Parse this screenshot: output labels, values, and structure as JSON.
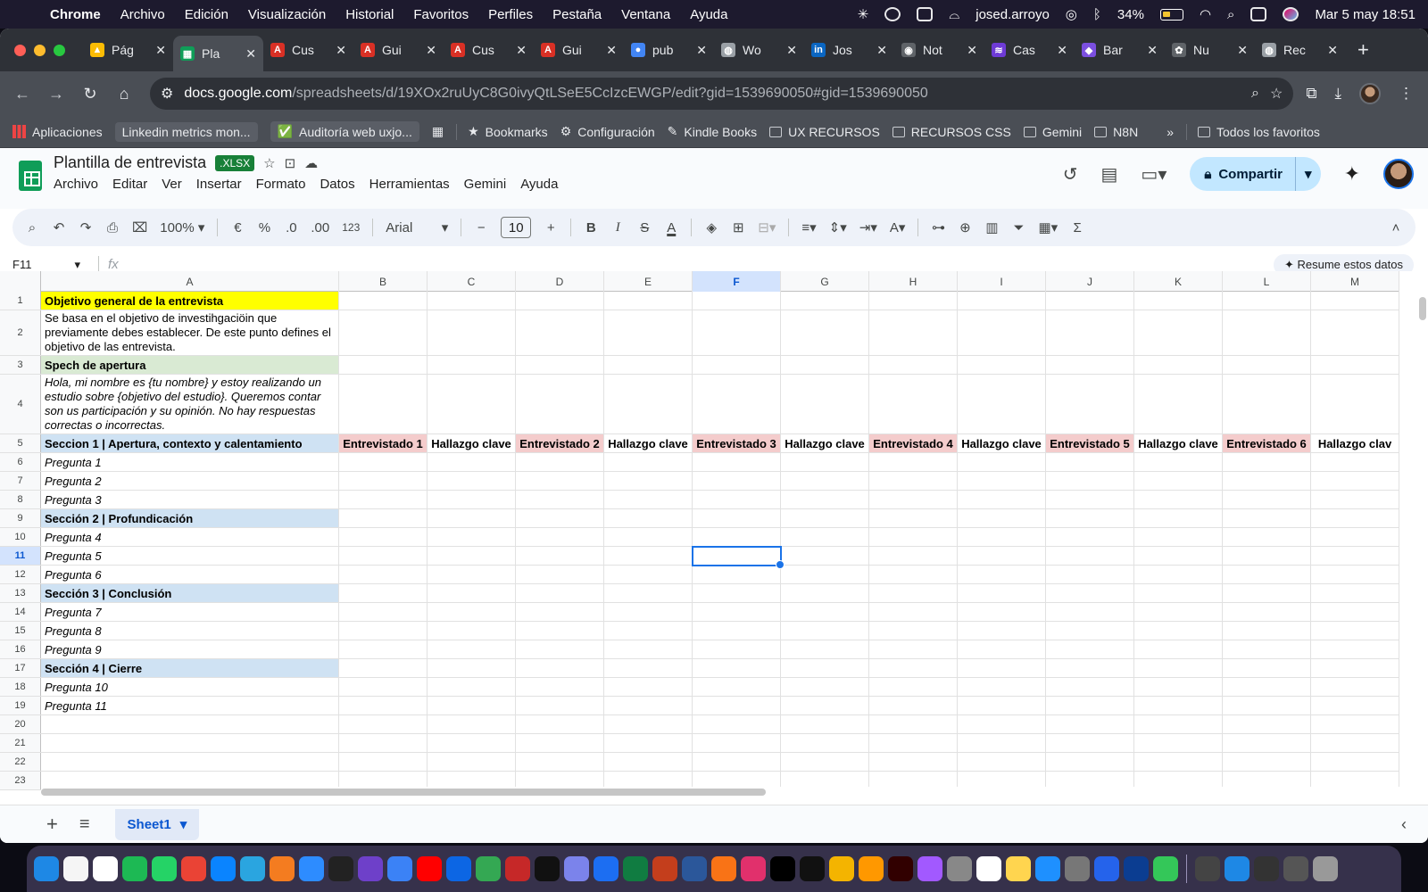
{
  "menubar": {
    "app": "Chrome",
    "items": [
      "Archivo",
      "Edición",
      "Visualización",
      "Historial",
      "Favoritos",
      "Perfiles",
      "Pestaña",
      "Ventana",
      "Ayuda"
    ],
    "user": "josed.arroyo",
    "battery": "34%",
    "datetime": "Mar 5 may  18:51"
  },
  "tabs": [
    {
      "label": "Pág",
      "color": "#fbbc04",
      "glyph": "▲"
    },
    {
      "label": "Pla",
      "color": "#0f9d58",
      "glyph": "▦",
      "active": true
    },
    {
      "label": "Cus",
      "color": "#d93025",
      "glyph": "A"
    },
    {
      "label": "Gui",
      "color": "#d93025",
      "glyph": "A"
    },
    {
      "label": "Cus",
      "color": "#d93025",
      "glyph": "A"
    },
    {
      "label": "Gui",
      "color": "#d93025",
      "glyph": "A"
    },
    {
      "label": "pub",
      "color": "#4285f4",
      "glyph": "●"
    },
    {
      "label": "Wo",
      "color": "#9aa0a6",
      "glyph": "◍"
    },
    {
      "label": "Jos",
      "color": "#0a66c2",
      "glyph": "in"
    },
    {
      "label": "Not",
      "color": "#5f6368",
      "glyph": "◉"
    },
    {
      "label": "Cas",
      "color": "#6e3bd6",
      "glyph": "≋"
    },
    {
      "label": "Bar",
      "color": "#7b4fe0",
      "glyph": "◆"
    },
    {
      "label": "Nu",
      "color": "#5f6368",
      "glyph": "✿"
    },
    {
      "label": "Rec",
      "color": "#9aa0a6",
      "glyph": "◍"
    }
  ],
  "toolbar": {
    "url_host": "docs.google.com",
    "url_path": "/spreadsheets/d/19XOx2ruUyC8G0ivyQtLSeE5CcIzcEWGP/edit?gid=1539690050#gid=1539690050"
  },
  "bookmarks": {
    "apps": "Aplicaciones",
    "items": [
      "Linkedin metrics mon...",
      "Auditoría web uxjo...",
      "Bookmarks",
      "Configuración",
      "Kindle Books",
      "UX RECURSOS",
      "RECURSOS CSS",
      "Gemini",
      "N8N"
    ],
    "more": "»",
    "all": "Todos los favoritos"
  },
  "doc": {
    "title": "Plantilla de entrevista",
    "badge": ".XLSX",
    "menus": [
      "Archivo",
      "Editar",
      "Ver",
      "Insertar",
      "Formato",
      "Datos",
      "Herramientas",
      "Gemini",
      "Ayuda"
    ],
    "share": "Compartir"
  },
  "format": {
    "zoom": "100%",
    "currency": "€",
    "percent": "%",
    "dec_less": ".0",
    "dec_more": ".00",
    "numfmt": "123",
    "font": "Arial",
    "size": "10"
  },
  "formula": {
    "namebox": "F11",
    "fx": "fx",
    "summary": "Resume estos datos"
  },
  "columns": [
    "A",
    "B",
    "C",
    "D",
    "E",
    "F",
    "G",
    "H",
    "I",
    "J",
    "K",
    "L",
    "M"
  ],
  "selected": {
    "col": "F",
    "row": "11"
  },
  "rows": [
    {
      "n": "1",
      "cells": [
        {
          "t": "Objetivo general de la entrevista",
          "s": "b yl"
        }
      ]
    },
    {
      "n": "2",
      "cells": [
        {
          "t": "Se basa en el objetivo de investihgaciöin que previamente debes establecer. De este punto defines el objetivo de las entrevista.",
          "s": "wrap"
        }
      ]
    },
    {
      "n": "3",
      "cells": [
        {
          "t": "Spech de apertura",
          "s": "b gr"
        }
      ]
    },
    {
      "n": "4",
      "cells": [
        {
          "t": "Hola, mi nombre es {tu nombre} y estoy realizando un estudio sobre {objetivo del estudio}. Queremos contar son us participación y su opinión. No hay respuestas correctas o incorrectas.",
          "s": "wrap i"
        }
      ]
    },
    {
      "n": "5",
      "cells": [
        {
          "t": "Seccion 1 | Apertura, contexto y calentamiento",
          "s": "b bl"
        },
        {
          "t": "Entrevistado 1",
          "s": "b pk"
        },
        {
          "t": "Hallazgo clave",
          "s": "b"
        },
        {
          "t": "Entrevistado 2",
          "s": "b pk"
        },
        {
          "t": "Hallazgo clave",
          "s": "b"
        },
        {
          "t": "Entrevistado 3",
          "s": "b pk"
        },
        {
          "t": "Hallazgo clave",
          "s": "b"
        },
        {
          "t": "Entrevistado 4",
          "s": "b pk"
        },
        {
          "t": "Hallazgo clave",
          "s": "b"
        },
        {
          "t": "Entrevistado 5",
          "s": "b pk"
        },
        {
          "t": "Hallazgo clave",
          "s": "b"
        },
        {
          "t": "Entrevistado 6",
          "s": "b pk"
        },
        {
          "t": "Hallazgo clav",
          "s": "b"
        }
      ]
    },
    {
      "n": "6",
      "cells": [
        {
          "t": "Pregunta 1",
          "s": "i"
        }
      ]
    },
    {
      "n": "7",
      "cells": [
        {
          "t": "Pregunta 2",
          "s": "i"
        }
      ]
    },
    {
      "n": "8",
      "cells": [
        {
          "t": "Pregunta 3",
          "s": "i"
        }
      ]
    },
    {
      "n": "9",
      "cells": [
        {
          "t": "Sección 2 | Profundicación",
          "s": "b bl"
        }
      ]
    },
    {
      "n": "10",
      "cells": [
        {
          "t": "Pregunta 4",
          "s": "i"
        }
      ]
    },
    {
      "n": "11",
      "cells": [
        {
          "t": "Pregunta 5",
          "s": "i"
        }
      ]
    },
    {
      "n": "12",
      "cells": [
        {
          "t": "Pregunta 6",
          "s": "i"
        }
      ]
    },
    {
      "n": "13",
      "cells": [
        {
          "t": "Sección 3 | Conclusión",
          "s": "b bl"
        }
      ]
    },
    {
      "n": "14",
      "cells": [
        {
          "t": "Pregunta 7",
          "s": "i"
        }
      ]
    },
    {
      "n": "15",
      "cells": [
        {
          "t": "Pregunta 8",
          "s": "i"
        }
      ]
    },
    {
      "n": "16",
      "cells": [
        {
          "t": "Pregunta 9",
          "s": "i"
        }
      ]
    },
    {
      "n": "17",
      "cells": [
        {
          "t": "Sección 4 | Cierre",
          "s": "b bl"
        }
      ]
    },
    {
      "n": "18",
      "cells": [
        {
          "t": "Pregunta 10",
          "s": "i"
        }
      ]
    },
    {
      "n": "19",
      "cells": [
        {
          "t": "Pregunta 11",
          "s": "i"
        }
      ]
    },
    {
      "n": "20",
      "cells": []
    },
    {
      "n": "21",
      "cells": []
    },
    {
      "n": "22",
      "cells": []
    },
    {
      "n": "23",
      "cells": []
    }
  ],
  "sheet_tab": "Sheet1",
  "dock_colors": [
    "#1e88e5",
    "#f5f5f5",
    "#ffffff",
    "#1db954",
    "#25d366",
    "#ea4335",
    "#0a84ff",
    "#2aa5e0",
    "#f47c20",
    "#2d8cff",
    "#222",
    "#6e40c9",
    "#3b82f6",
    "#ff0000",
    "#0c66e4",
    "#34a853",
    "#c62828",
    "#111",
    "#7b83eb",
    "#1c6ef2",
    "#107c41",
    "#c43e1c",
    "#2b579a",
    "#f97316",
    "#e1306c",
    "#000",
    "#111",
    "#f4b400",
    "#ff9800",
    "#310000",
    "#a259ff",
    "#888",
    "#fff",
    "#ffd54f",
    "#1e90ff",
    "#777",
    "#2563eb",
    "#0b3d91",
    "#34c759",
    "#444",
    "#1e88e5",
    "#333",
    "#555",
    "#999"
  ]
}
